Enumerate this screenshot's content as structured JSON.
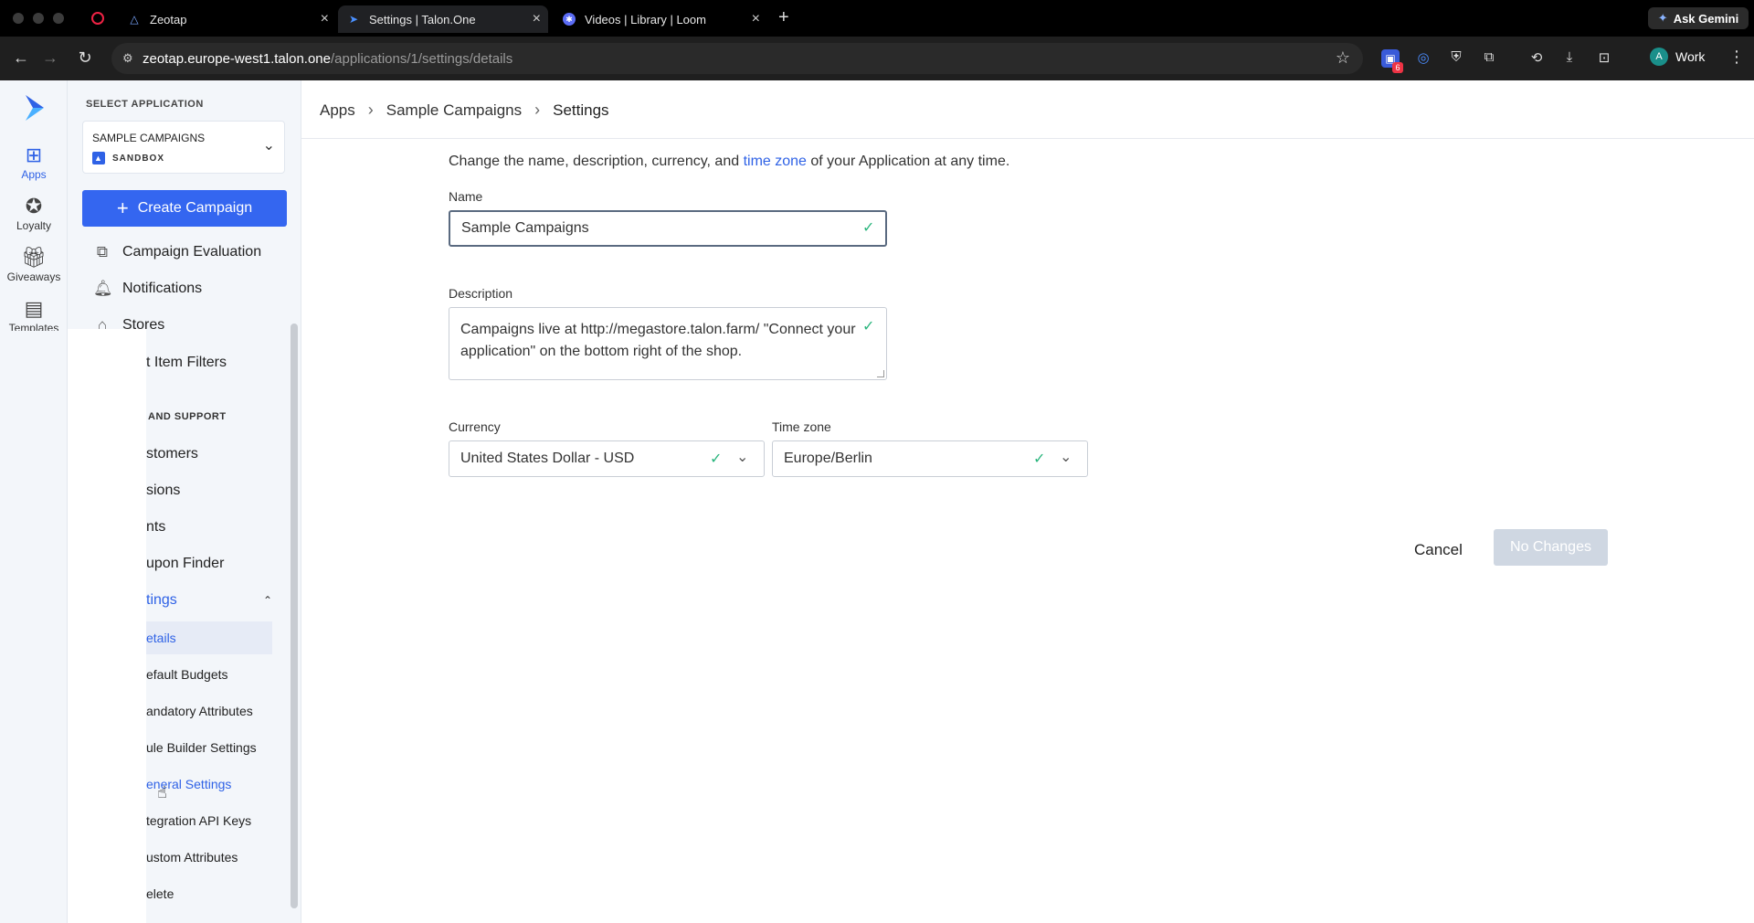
{
  "browser": {
    "tabs": [
      {
        "title": "Zeotap",
        "icon": "zeotap-icon"
      },
      {
        "title": "Settings | Talon.One",
        "icon": "talon-icon"
      },
      {
        "title": "Videos | Library | Loom",
        "icon": "loom-icon"
      }
    ],
    "ask_gemini": "Ask Gemini",
    "url_host": "zeotap.europe-west1.talon.one",
    "url_path": "/applications/1/settings/details",
    "profile_initial": "A",
    "profile_name": "Work",
    "ext_badge": "6"
  },
  "rail": {
    "items": [
      {
        "label": "Apps",
        "icon": "apps-icon"
      },
      {
        "label": "Loyalty",
        "icon": "loyalty-icon"
      },
      {
        "label": "Giveaways",
        "icon": "giveaways-icon"
      },
      {
        "label": "Templates",
        "icon": "templates-icon"
      }
    ]
  },
  "sidebar": {
    "select_label": "SELECT APPLICATION",
    "app_name": "SAMPLE CAMPAIGNS",
    "app_env": "SANDBOX",
    "create_label": "Create Campaign",
    "nav": [
      {
        "label": "Campaign Evaluation",
        "icon": "evaluation-icon"
      },
      {
        "label": "Notifications",
        "icon": "bell-icon"
      },
      {
        "label": "Stores",
        "icon": "store-icon"
      }
    ],
    "rest": {
      "item_filters": "t Item Filters",
      "section": "AND SUPPORT",
      "items": [
        "stomers",
        "sions",
        "nts",
        "upon Finder"
      ],
      "settings": "tings",
      "sub": [
        "etails",
        "efault Budgets",
        "andatory Attributes",
        "ule Builder Settings",
        "eneral Settings",
        "tegration API Keys",
        "ustom Attributes",
        "elete"
      ]
    }
  },
  "main": {
    "breadcrumb": [
      "Apps",
      "Sample Campaigns",
      "Settings"
    ],
    "intro_before": "Change the name, description, currency, and ",
    "intro_link": "time zone",
    "intro_after": " of your Application at any time.",
    "name_label": "Name",
    "name_value": "Sample Campaigns",
    "desc_label": "Description",
    "desc_value": "Campaigns live at http://megastore.talon.farm/ \"Connect your application\" on the bottom right of the shop.",
    "currency_label": "Currency",
    "currency_value": "United States Dollar - USD",
    "tz_label": "Time zone",
    "tz_value": "Europe/Berlin",
    "cancel_label": "Cancel",
    "submit_label": "No Changes"
  },
  "colors": {
    "accent": "#3466f0",
    "success": "#2ab57d",
    "disabled": "#cfd7e2"
  }
}
